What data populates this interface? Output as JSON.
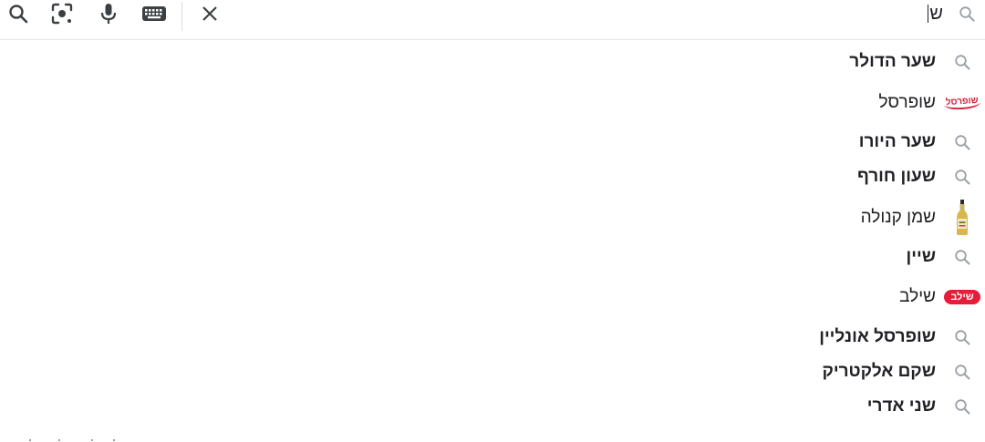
{
  "toolbar": {
    "search_icon": "search-icon",
    "lens_icon": "camera-lens-icon",
    "voice_icon": "microphone-icon",
    "keyboard_icon": "keyboard-icon",
    "clear_icon": "close-icon"
  },
  "search": {
    "query": "ש"
  },
  "suggestions": [
    {
      "text": "שער הדולר",
      "bold": true,
      "icon": "search-icon"
    },
    {
      "text": "שופרסל",
      "bold": false,
      "icon": "shufersal-logo",
      "logo_text": "שופרסל"
    },
    {
      "text": "שער היורו",
      "bold": true,
      "icon": "search-icon"
    },
    {
      "text": "שעון חורף",
      "bold": true,
      "icon": "search-icon"
    },
    {
      "text": "שמן קנולה",
      "bold": false,
      "icon": "oil-bottle-image"
    },
    {
      "text": "שיין",
      "bold": true,
      "icon": "search-icon"
    },
    {
      "text": "שילב",
      "bold": false,
      "icon": "shilav-logo",
      "logo_text": "שילב"
    },
    {
      "text": "שופרסל אונליין",
      "bold": true,
      "icon": "search-icon"
    },
    {
      "text": "שקם אלקטריק",
      "bold": true,
      "icon": "search-icon"
    },
    {
      "text": "שני אדרי",
      "bold": true,
      "icon": "search-icon"
    }
  ],
  "colors": {
    "icon_gray": "#9aa0a6",
    "toolbar_dark": "#3c4043",
    "brand_red": "#e31e3b"
  }
}
